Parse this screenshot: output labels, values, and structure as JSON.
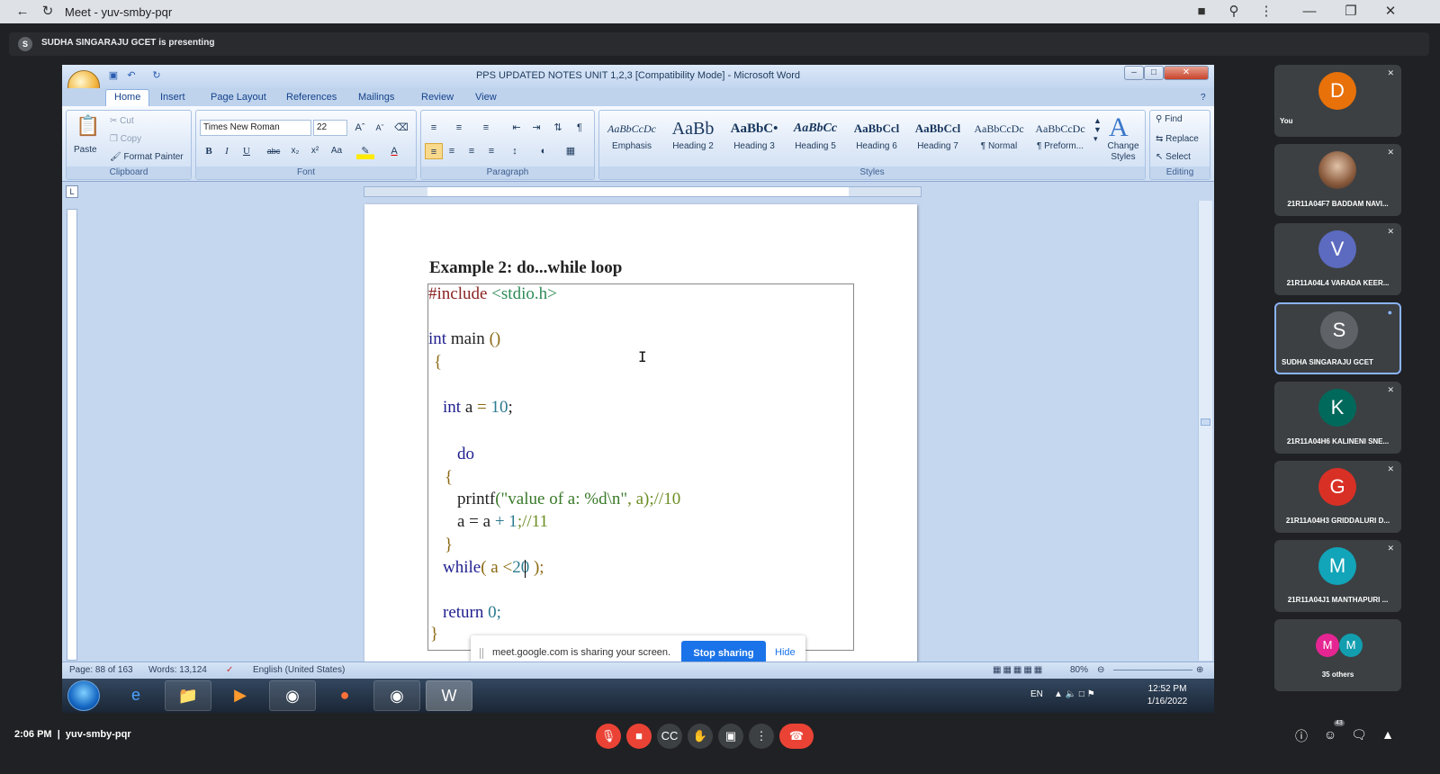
{
  "chrome": {
    "title": "Meet - yuv-smby-pqr"
  },
  "meet": {
    "presenting_initial": "S",
    "presenting_text": "SUDHA SINGARAJU GCET is presenting",
    "bottom_time": "2:06 PM",
    "separator": "|",
    "meeting_code": "yuv-smby-pqr",
    "people_count": "43",
    "participants": [
      {
        "initial": "D",
        "name": "You",
        "color": "#e8710a"
      },
      {
        "initial": "",
        "name": "21R11A04F7 BADDAM NAVI...",
        "color": "#7a5c4a"
      },
      {
        "initial": "V",
        "name": "21R11A04L4 VARADA KEER...",
        "color": "#5c6bc0"
      },
      {
        "initial": "S",
        "name": "SUDHA SINGARAJU GCET",
        "color": "#5f6368"
      },
      {
        "initial": "K",
        "name": "21R11A04H6 KALINENI SNE...",
        "color": "#00695c"
      },
      {
        "initial": "G",
        "name": "21R11A04H3 GRIDDALURI D...",
        "color": "#d93025"
      },
      {
        "initial": "M",
        "name": "21R11A04J1 MANTHAPURI ...",
        "color": "#12a4b8"
      }
    ],
    "others": {
      "initials": [
        "M",
        "M"
      ],
      "label": "35 others"
    }
  },
  "word": {
    "title": "PPS UPDATED NOTES UNIT 1,2,3 [Compatibility Mode] - Microsoft Word",
    "tabs": [
      "Home",
      "Insert",
      "Page Layout",
      "References",
      "Mailings",
      "Review",
      "View"
    ],
    "clipboard": {
      "paste": "Paste",
      "cut": "Cut",
      "copy": "Copy",
      "format_painter": "Format Painter",
      "label": "Clipboard"
    },
    "font": {
      "name": "Times New Roman",
      "size": "22",
      "label": "Font"
    },
    "paragraph": {
      "label": "Paragraph"
    },
    "styles": {
      "tiles": [
        {
          "preview": "AaBbCcDc",
          "name": "Emphasis"
        },
        {
          "preview": "AaBb",
          "name": "Heading 2"
        },
        {
          "preview": "AaBbC•",
          "name": "Heading 3"
        },
        {
          "preview": "AaBbCc",
          "name": "Heading 5"
        },
        {
          "preview": "AaBbCcl",
          "name": "Heading 6"
        },
        {
          "preview": "AaBbCcl",
          "name": "Heading 7"
        },
        {
          "preview": "AaBbCcDc",
          "name": "¶ Normal"
        },
        {
          "preview": "AaBbCcDc",
          "name": "¶ Preform..."
        }
      ],
      "change": "Change Styles",
      "label": "Styles"
    },
    "editing": {
      "find": "Find",
      "replace": "Replace",
      "select": "Select",
      "label": "Editing"
    },
    "doc": {
      "heading": "Example 2: do...while loop",
      "code": {
        "l1a": "#include ",
        "l1b": "<stdio.h>",
        "l2a": "int",
        "l2b": " main ",
        "l2c": "()",
        "l3": "{",
        "l4a": "int",
        "l4b": " a ",
        "l4c": "= ",
        "l4d": "10",
        "l4e": ";",
        "l5": "do",
        "l6": "{",
        "l7a": "printf",
        "l7b": "(\"value of a: %d\\n\"",
        "l7c": ", a);//10",
        "l8a": "a = a ",
        "l8b": "+ 1",
        "l8c": ";//11",
        "l9": "}",
        "l10a": "while",
        "l10b": "( a <",
        "l10c": "20",
        "l10d": " );",
        "l11a": "return",
        "l11b": " 0;",
        "l12": "}"
      }
    },
    "share": {
      "message": "meet.google.com is sharing your screen.",
      "stop": "Stop sharing",
      "hide": "Hide"
    },
    "status": {
      "page": "Page: 88 of 163",
      "words": "Words: 13,124",
      "lang": "English (United States)",
      "zoom": "80%"
    },
    "tray": {
      "lang": "EN",
      "time": "12:52 PM",
      "date": "1/16/2022"
    }
  }
}
